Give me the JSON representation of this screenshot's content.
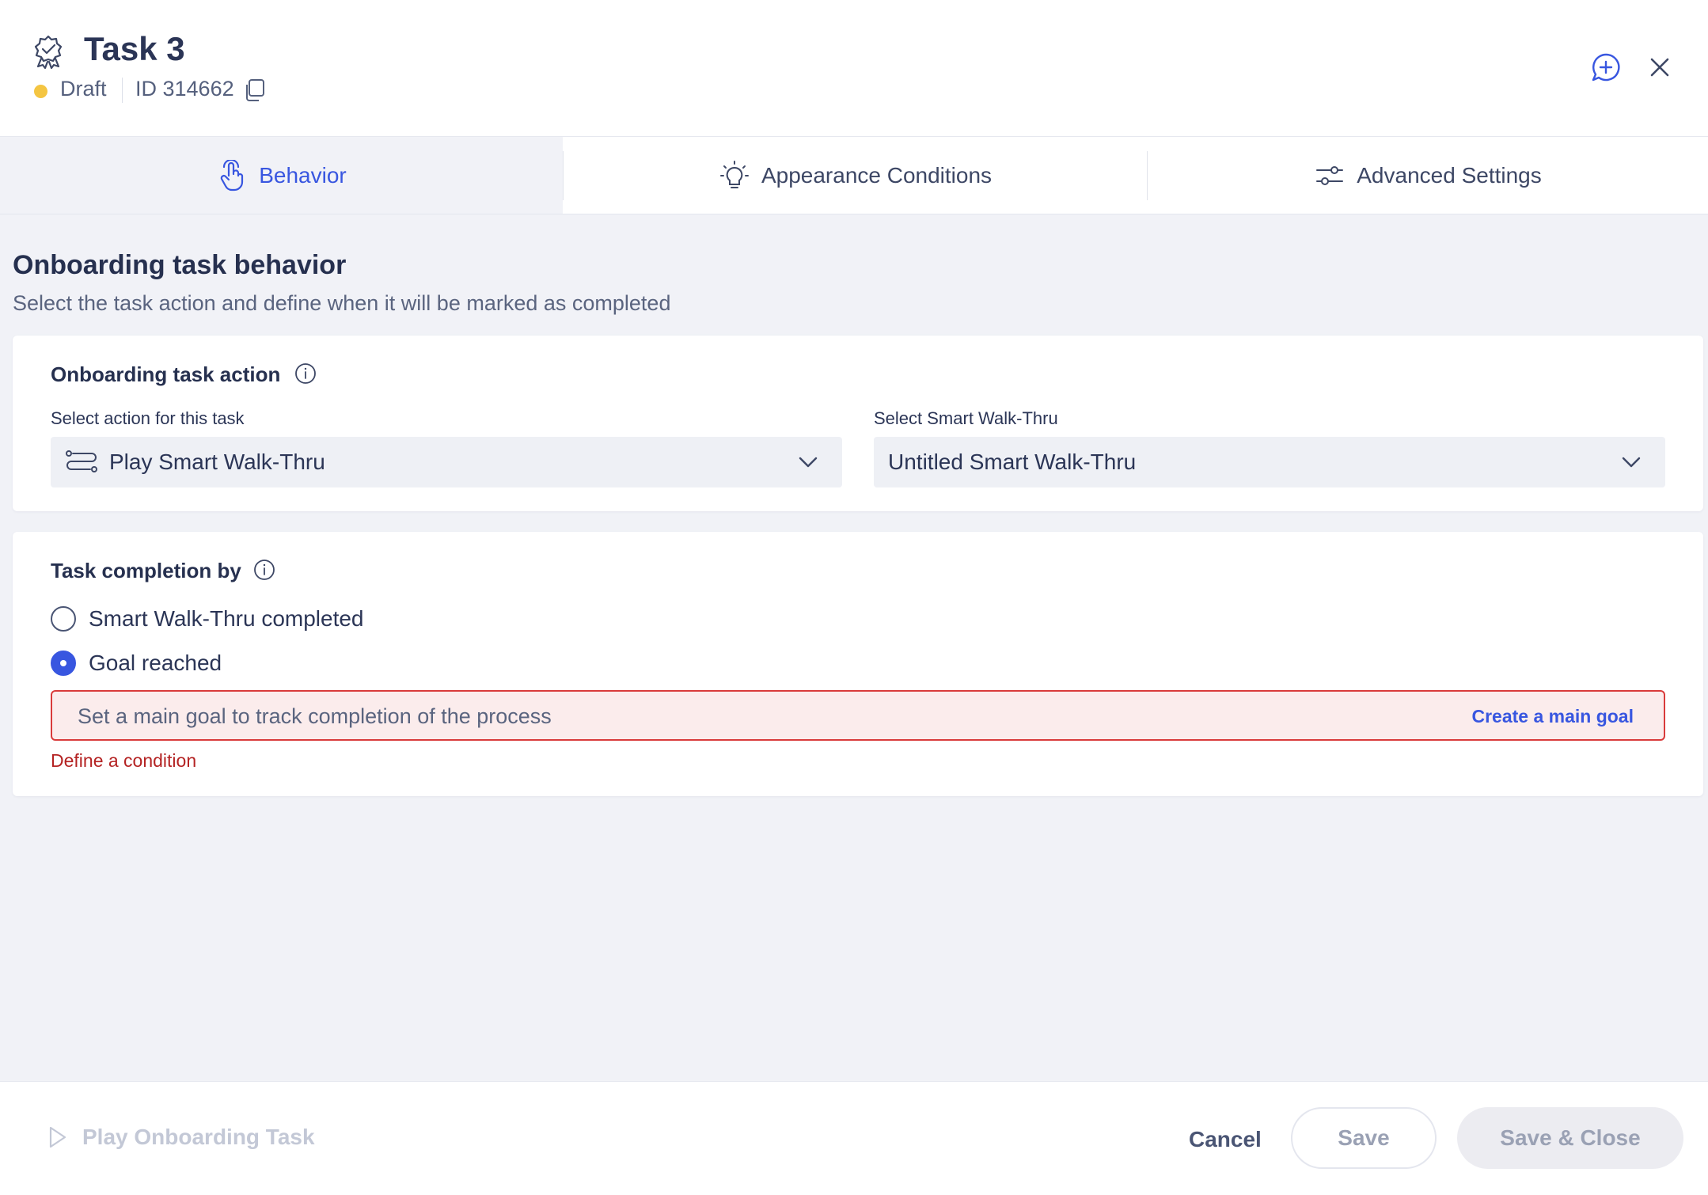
{
  "header": {
    "title": "Task 3",
    "status": "Draft",
    "status_color": "#f4c542",
    "id_label": "ID 314662",
    "icons": [
      "task-badge-icon",
      "copy-icon",
      "add-comment-icon",
      "close-icon"
    ]
  },
  "tabs": [
    {
      "label": "Behavior",
      "icon": "hand-pointer-icon",
      "active": true
    },
    {
      "label": "Appearance Conditions",
      "icon": "lightbulb-icon",
      "active": false
    },
    {
      "label": "Advanced Settings",
      "icon": "sliders-icon",
      "active": false
    }
  ],
  "main": {
    "title": "Onboarding task behavior",
    "subtitle": "Select the task action and define when it will be marked as completed",
    "action_card": {
      "title": "Onboarding task action",
      "action_label": "Select action for this task",
      "action_value": "Play Smart Walk-Thru",
      "walkthru_label": "Select Smart Walk-Thru",
      "walkthru_value": "Untitled Smart Walk-Thru"
    },
    "completion_card": {
      "title": "Task completion by",
      "options": [
        {
          "label": "Smart Walk-Thru completed",
          "checked": false
        },
        {
          "label": "Goal reached",
          "checked": true
        }
      ],
      "goal_message": "Set a main goal to track completion of the process",
      "goal_link": "Create a main goal",
      "error": "Define a condition"
    }
  },
  "footer": {
    "play_label": "Play Onboarding Task",
    "cancel_label": "Cancel",
    "save_label": "Save",
    "save_close_label": "Save & Close"
  },
  "colors": {
    "accent": "#3856e0",
    "error": "#d93b3b",
    "background": "#f1f2f7"
  }
}
